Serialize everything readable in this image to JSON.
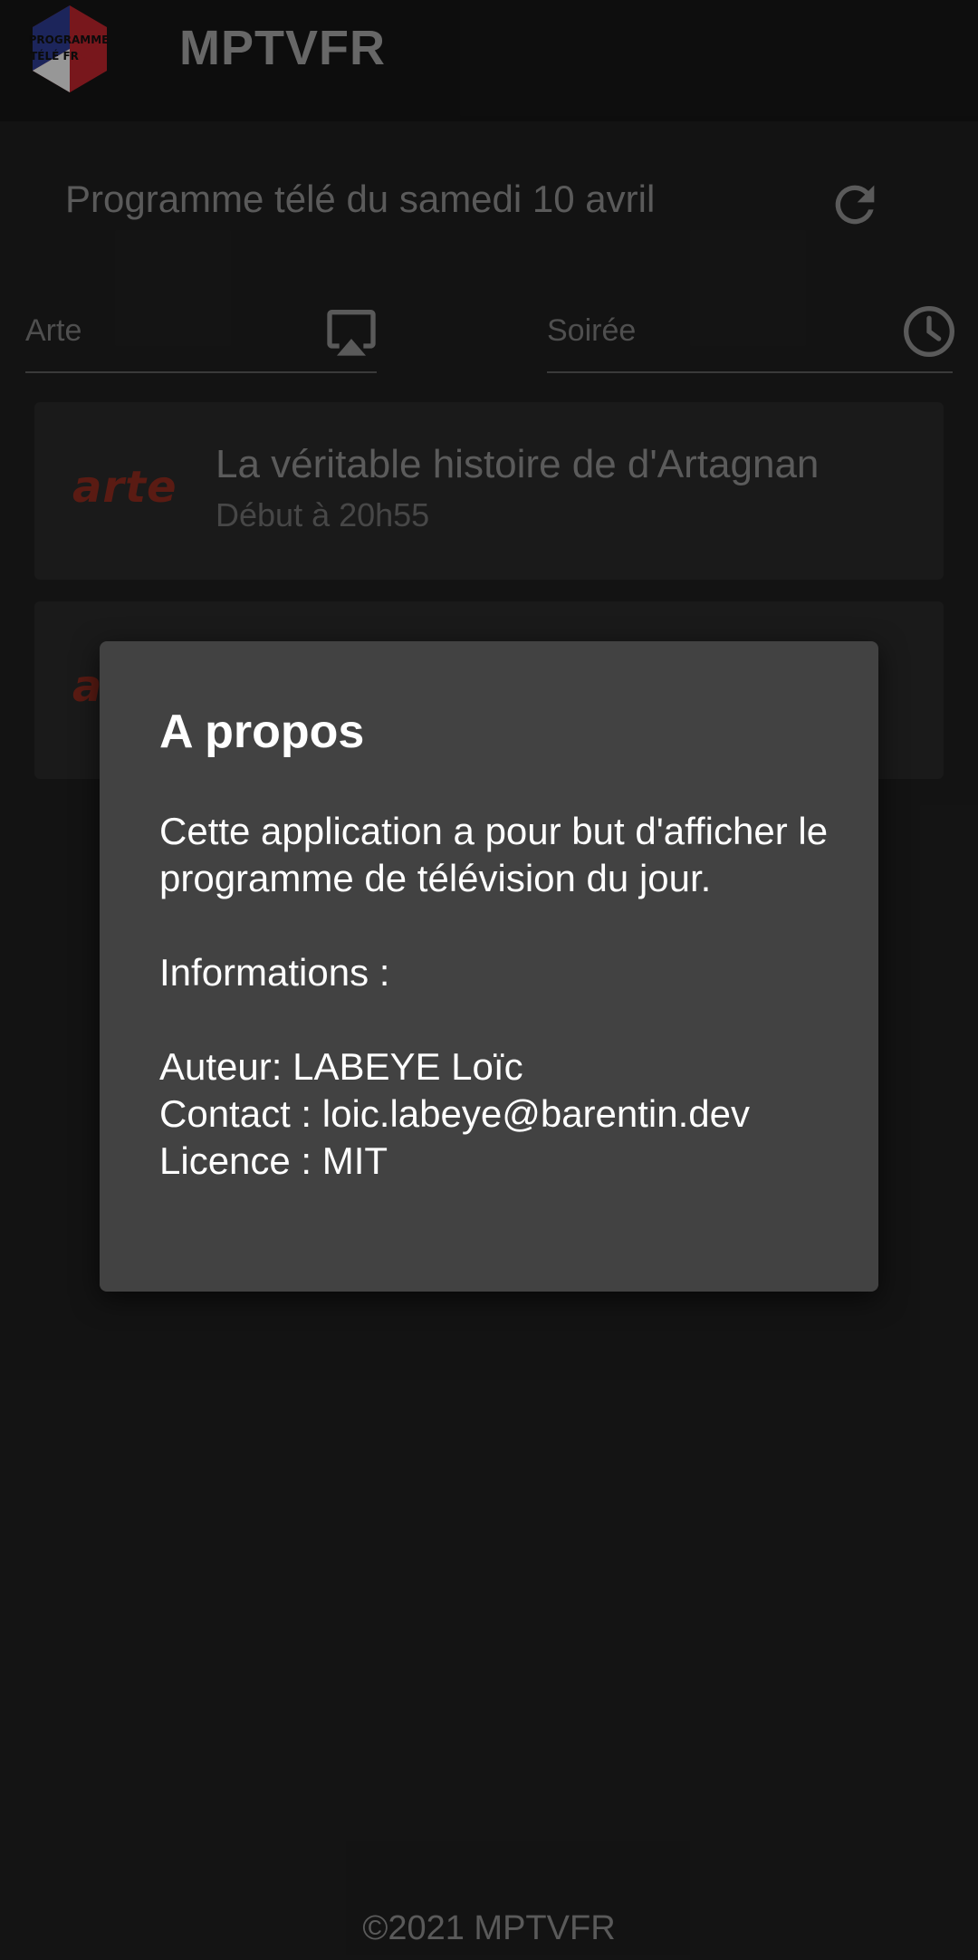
{
  "app": {
    "title": "MPTVFR",
    "logo_text_line1": "PROGRAMME",
    "logo_text_line2": "TÉLÉ FR"
  },
  "page": {
    "title": "Programme télé du samedi 10 avril",
    "refresh_icon": "refresh-icon"
  },
  "filters": {
    "channel": {
      "value": "Arte",
      "icon": "airplay-tv-icon"
    },
    "time": {
      "value": "Soirée",
      "icon": "clock-icon"
    }
  },
  "programs": [
    {
      "channel_logo": "arte",
      "title": "La véritable histoire de d'Artagnan",
      "time": "Début à 20h55"
    },
    {
      "channel_logo": "arte",
      "title": "",
      "time": ""
    }
  ],
  "dialog": {
    "title": "A propos",
    "description": "Cette application a pour but d'afficher le programme de télévision du jour.",
    "info_heading": "Informations :",
    "author": "Auteur: LABEYE Loïc",
    "contact": "Contact : loic.labeye@barentin.dev",
    "license": "Licence : MIT"
  },
  "footer": {
    "copyright": "©2021 MPTVFR"
  },
  "colors": {
    "background": "#1e1e1e",
    "appbar": "#151515",
    "card": "#282828",
    "dialog": "#424242",
    "arte_red": "#8b2a1e",
    "logo_blue": "#2b3a8c",
    "logo_red": "#b8242c",
    "logo_white": "#e8e8e8"
  }
}
